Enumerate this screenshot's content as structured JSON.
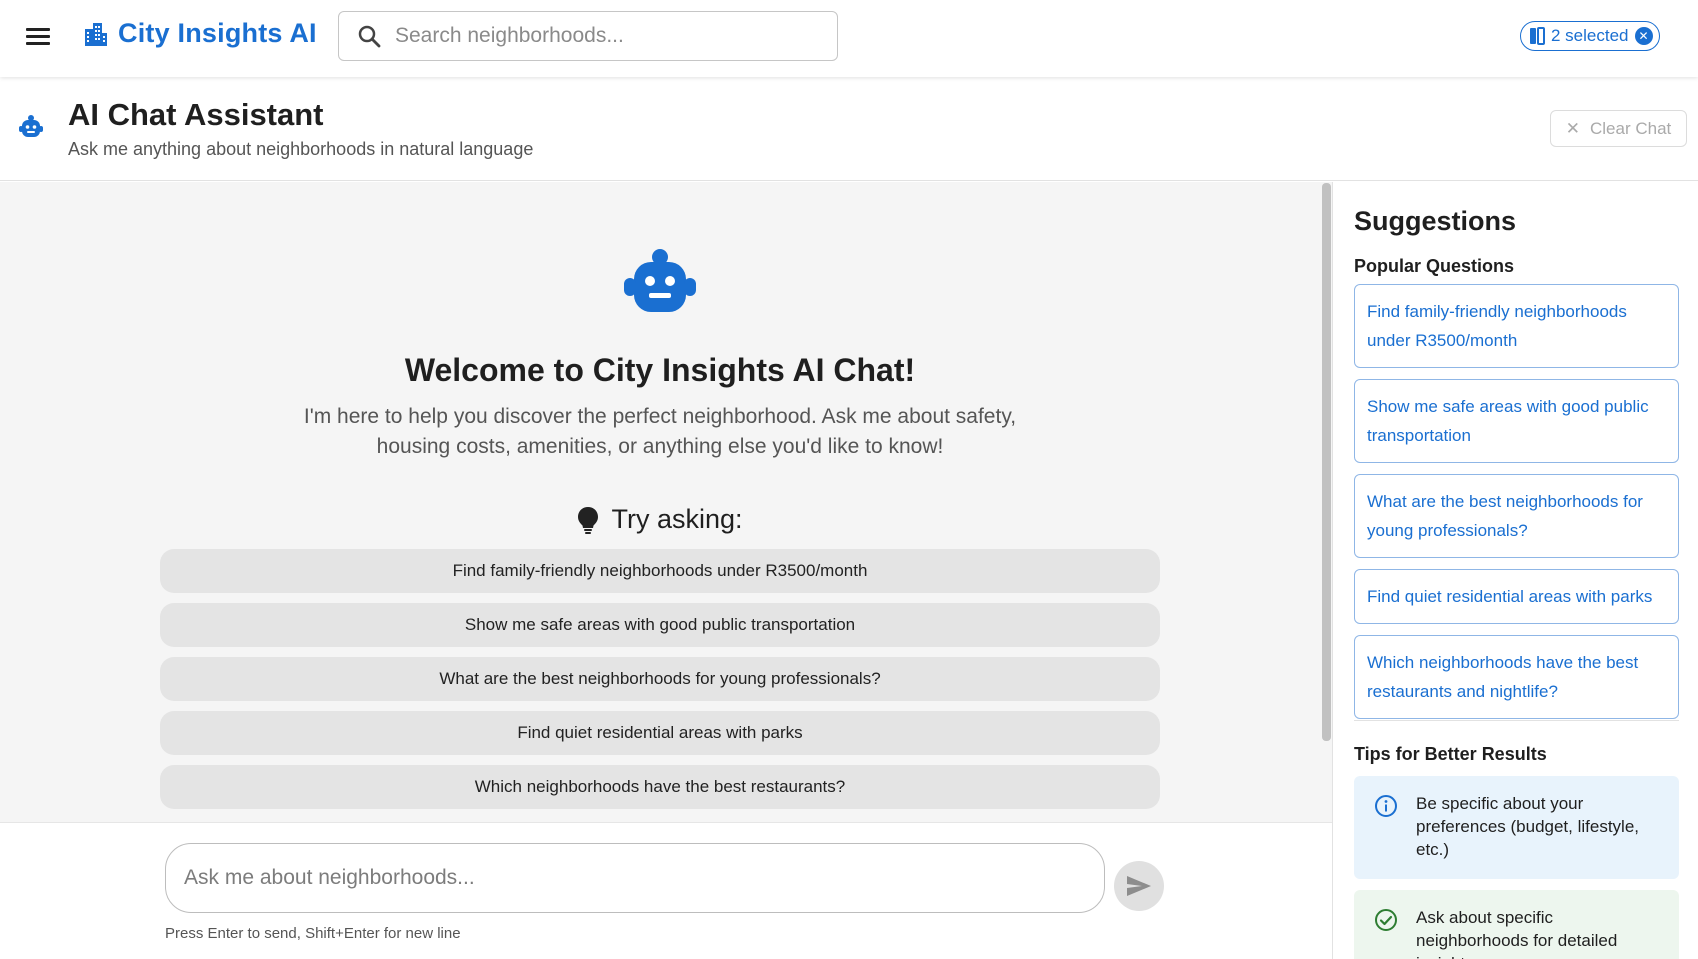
{
  "app": {
    "title": "City Insights AI",
    "brand_color": "#1a6fd1",
    "menu_icon": "hamburger-menu-icon",
    "brand_icon": "city-buildings-icon"
  },
  "search": {
    "placeholder": "Search neighborhoods...",
    "value": ""
  },
  "selection": {
    "label": "2 selected"
  },
  "page_header": {
    "title": "AI Chat Assistant",
    "subtitle": "Ask me anything about neighborhoods in natural language",
    "clear_label": "Clear Chat"
  },
  "welcome": {
    "title": "Welcome to City Insights AI Chat!",
    "description": "I'm here to help you discover the perfect neighborhood. Ask me about safety, housing costs, amenities, or anything else you'd like to know!",
    "try_label": "Try asking:",
    "suggestions": [
      "Find family-friendly neighborhoods under R3500/month",
      "Show me safe areas with good public transportation",
      "What are the best neighborhoods for young professionals?",
      "Find quiet residential areas with parks",
      "Which neighborhoods have the best restaurants?"
    ]
  },
  "composer": {
    "placeholder": "Ask me about neighborhoods...",
    "value": "",
    "hint": "Press Enter to send, Shift+Enter for new line"
  },
  "sidebar": {
    "title": "Suggestions",
    "popular_title": "Popular Questions",
    "popular": [
      "Find family-friendly neighborhoods under R3500/month",
      "Show me safe areas with good public transportation",
      "What are the best neighborhoods for young professionals?",
      "Find quiet residential areas with parks",
      "Which neighborhoods have the best restaurants and nightlife?"
    ],
    "tips_title": "Tips for Better Results",
    "tips": [
      {
        "text": "Be specific about your preferences (budget, lifestyle, etc.)",
        "icon": "info-icon",
        "color": "#e8f3fc"
      },
      {
        "text": "Ask about specific neighborhoods for detailed insights",
        "icon": "check-circle-icon",
        "color": "#edf6ee"
      }
    ]
  }
}
